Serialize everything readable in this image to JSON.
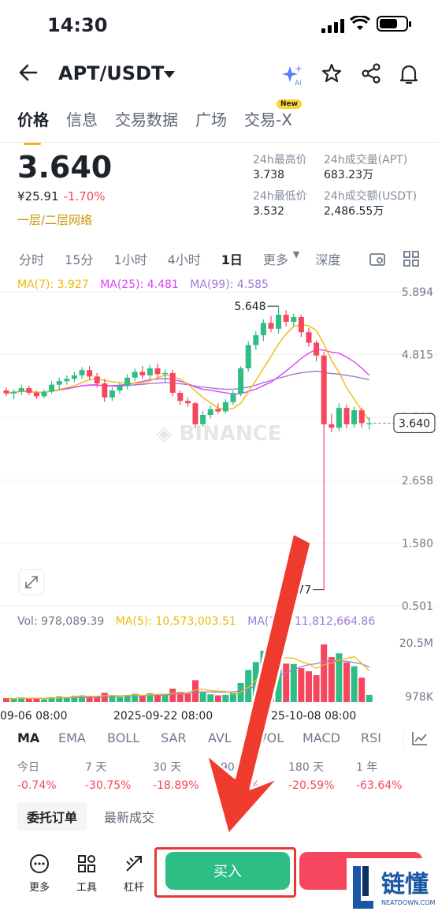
{
  "status": {
    "time": "14:30"
  },
  "header": {
    "pair": "APT/USDT"
  },
  "tabs": [
    {
      "label": "价格",
      "active": true
    },
    {
      "label": "信息"
    },
    {
      "label": "交易数据"
    },
    {
      "label": "广场"
    },
    {
      "label": "交易-X",
      "badge": "New"
    }
  ],
  "ticker": {
    "price": "3.640",
    "cny": "¥25.91",
    "change": "-1.70%",
    "network": "一层/二层网络",
    "stats": {
      "high_label": "24h最高价",
      "high": "3.738",
      "vol_label": "24h成交量(APT)",
      "vol": "683.23万",
      "low_label": "24h最低价",
      "low": "3.532",
      "amt_label": "24h成交额(USDT)",
      "amt": "2,486.55万"
    }
  },
  "intervals": [
    "分时",
    "15分",
    "1小时",
    "4小时",
    "1日",
    "更多",
    "深度"
  ],
  "active_interval": "1日",
  "ma": {
    "ma7": "MA(7): 3.927",
    "ma25": "MA(25): 4.481",
    "ma99": "MA(99): 4.585"
  },
  "colors": {
    "up": "#2ebd85",
    "down": "#f6465d",
    "ma7": "#f0b90b",
    "ma25": "#e040fb",
    "ma99": "#9c7bd8",
    "accent": "#f0b90b"
  },
  "chart_data": {
    "type": "candlestick",
    "y_axis_ticks": [
      "5.894",
      "4.815",
      "3.737",
      "2.658",
      "1.580",
      "0.501"
    ],
    "y_range": [
      0.501,
      5.894
    ],
    "last_price": "3.640",
    "high_annotation": "5.648",
    "low_annotation": "0.777",
    "watermark": "BINANCE",
    "x_labels": [
      "09-06 08:00",
      "2025-09-22 08:00",
      "25-10-08 08:00"
    ],
    "candles": [
      [
        4.2,
        4.25,
        4.1,
        4.15
      ],
      [
        4.15,
        4.22,
        4.05,
        4.18
      ],
      [
        4.18,
        4.3,
        4.12,
        4.24
      ],
      [
        4.24,
        4.28,
        4.12,
        4.16
      ],
      [
        4.16,
        4.2,
        4.05,
        4.1
      ],
      [
        4.1,
        4.22,
        4.06,
        4.18
      ],
      [
        4.18,
        4.36,
        4.14,
        4.3
      ],
      [
        4.3,
        4.42,
        4.22,
        4.36
      ],
      [
        4.36,
        4.46,
        4.3,
        4.4
      ],
      [
        4.4,
        4.52,
        4.34,
        4.46
      ],
      [
        4.46,
        4.6,
        4.4,
        4.55
      ],
      [
        4.55,
        4.62,
        4.38,
        4.44
      ],
      [
        4.44,
        4.5,
        4.25,
        4.32
      ],
      [
        4.32,
        4.4,
        4.0,
        4.08
      ],
      [
        4.08,
        4.25,
        4.02,
        4.2
      ],
      [
        4.2,
        4.34,
        4.14,
        4.28
      ],
      [
        4.28,
        4.48,
        4.22,
        4.42
      ],
      [
        4.42,
        4.58,
        4.36,
        4.52
      ],
      [
        4.52,
        4.62,
        4.4,
        4.46
      ],
      [
        4.46,
        4.64,
        4.4,
        4.58
      ],
      [
        4.58,
        4.66,
        4.42,
        4.48
      ],
      [
        4.48,
        4.56,
        4.34,
        4.5
      ],
      [
        4.5,
        4.55,
        4.1,
        4.16
      ],
      [
        4.16,
        4.2,
        3.95,
        4.02
      ],
      [
        4.02,
        4.08,
        3.92,
        3.98
      ],
      [
        3.98,
        4.0,
        3.55,
        3.62
      ],
      [
        3.62,
        3.85,
        3.58,
        3.78
      ],
      [
        3.78,
        3.95,
        3.72,
        3.88
      ],
      [
        3.88,
        3.98,
        3.8,
        3.84
      ],
      [
        3.84,
        4.05,
        3.8,
        4.0
      ],
      [
        4.0,
        4.2,
        3.95,
        4.15
      ],
      [
        4.15,
        4.62,
        4.1,
        4.58
      ],
      [
        4.58,
        5.05,
        4.52,
        4.98
      ],
      [
        4.98,
        5.22,
        4.9,
        5.15
      ],
      [
        5.15,
        5.42,
        5.05,
        5.36
      ],
      [
        5.36,
        5.48,
        5.2,
        5.26
      ],
      [
        5.26,
        5.648,
        5.18,
        5.5
      ],
      [
        5.5,
        5.58,
        5.3,
        5.38
      ],
      [
        5.38,
        5.52,
        5.3,
        5.46
      ],
      [
        5.46,
        5.5,
        5.12,
        5.2
      ],
      [
        5.2,
        5.28,
        4.95,
        5.02
      ],
      [
        5.02,
        5.06,
        4.7,
        4.8
      ],
      [
        4.8,
        4.86,
        0.777,
        3.62
      ],
      [
        3.62,
        3.8,
        3.48,
        3.56
      ],
      [
        3.56,
        3.98,
        3.5,
        3.9
      ],
      [
        3.9,
        3.96,
        3.55,
        3.62
      ],
      [
        3.62,
        3.92,
        3.56,
        3.86
      ],
      [
        3.86,
        3.9,
        3.56,
        3.64
      ],
      [
        3.64,
        3.74,
        3.53,
        3.64
      ]
    ],
    "volume": {
      "label": "Vol: 978,089.39",
      "ma5": "MA(5): 10,573,003.51",
      "ma10": "MA(10): 11,812,664.86",
      "ticks": [
        "20.5M",
        "978K"
      ],
      "values": [
        1.5,
        1.2,
        1.8,
        1.4,
        1.6,
        1.1,
        1.9,
        2.2,
        2.0,
        2.4,
        2.6,
        2.1,
        2.0,
        3.6,
        2.4,
        2.0,
        2.8,
        3.2,
        2.6,
        3.4,
        3.0,
        2.8,
        5.2,
        4.0,
        3.2,
        8.5,
        3.8,
        3.0,
        2.6,
        2.8,
        3.6,
        7.4,
        12.5,
        15.6,
        20.0,
        16.4,
        19.2,
        15.0,
        14.8,
        13.2,
        12.0,
        10.5,
        22.5,
        17.5,
        19.0,
        15.5,
        14.0,
        9.5,
        2.8
      ]
    }
  },
  "indicators": [
    "MA",
    "EMA",
    "BOLL",
    "SAR",
    "AVL",
    "VOL",
    "MACD",
    "RSI"
  ],
  "performance": [
    {
      "label": "今日",
      "value": "-0.74%"
    },
    {
      "label": "7 天",
      "value": "-30.75%"
    },
    {
      "label": "30 天",
      "value": "-18.89%"
    },
    {
      "label": "90 天",
      "value": "-8.13%"
    },
    {
      "label": "180 天",
      "value": "-20.59%"
    },
    {
      "label": "1 年",
      "value": "-63.64%"
    }
  ],
  "book_tabs": {
    "orders": "委托订单",
    "trades": "最新成交"
  },
  "bottom": {
    "more": "更多",
    "tools": "工具",
    "leverage": "杠杆",
    "buy": "买入"
  },
  "watermark_logo": {
    "text": "链懂",
    "sub": "NEATDOWN.COM"
  }
}
